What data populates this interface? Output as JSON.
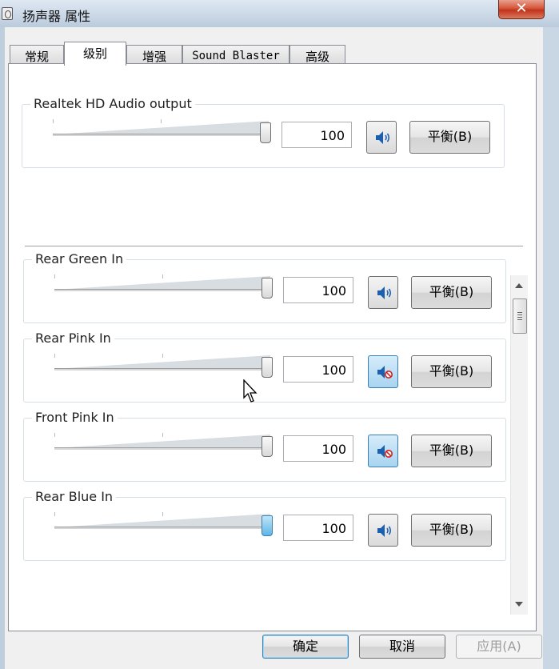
{
  "window": {
    "title": "扬声器 属性",
    "close_glyph": "✕"
  },
  "tabs": [
    {
      "label": "常规",
      "active": false
    },
    {
      "label": "级别",
      "active": true
    },
    {
      "label": "增强",
      "active": false
    },
    {
      "label": "Sound Blaster",
      "active": false
    },
    {
      "label": "高级",
      "active": false
    }
  ],
  "output": {
    "label": "Realtek HD Audio output",
    "value": "100",
    "muted": false,
    "balance_label": "平衡(B)"
  },
  "inputs": [
    {
      "label": "Rear Green In",
      "value": "100",
      "muted": false,
      "balance_label": "平衡(B)"
    },
    {
      "label": "Rear Pink In",
      "value": "100",
      "muted": true,
      "balance_label": "平衡(B)"
    },
    {
      "label": "Front Pink In",
      "value": "100",
      "muted": true,
      "balance_label": "平衡(B)"
    },
    {
      "label": "Rear Blue In",
      "value": "100",
      "muted": false,
      "balance_label": "平衡(B)"
    }
  ],
  "buttons": {
    "ok": "确定",
    "cancel": "取消",
    "apply": "应用(A)"
  },
  "colors": {
    "accent": "#3c7fb1",
    "speaker_blue": "#1b5fb0",
    "mute_red": "#d02020"
  }
}
